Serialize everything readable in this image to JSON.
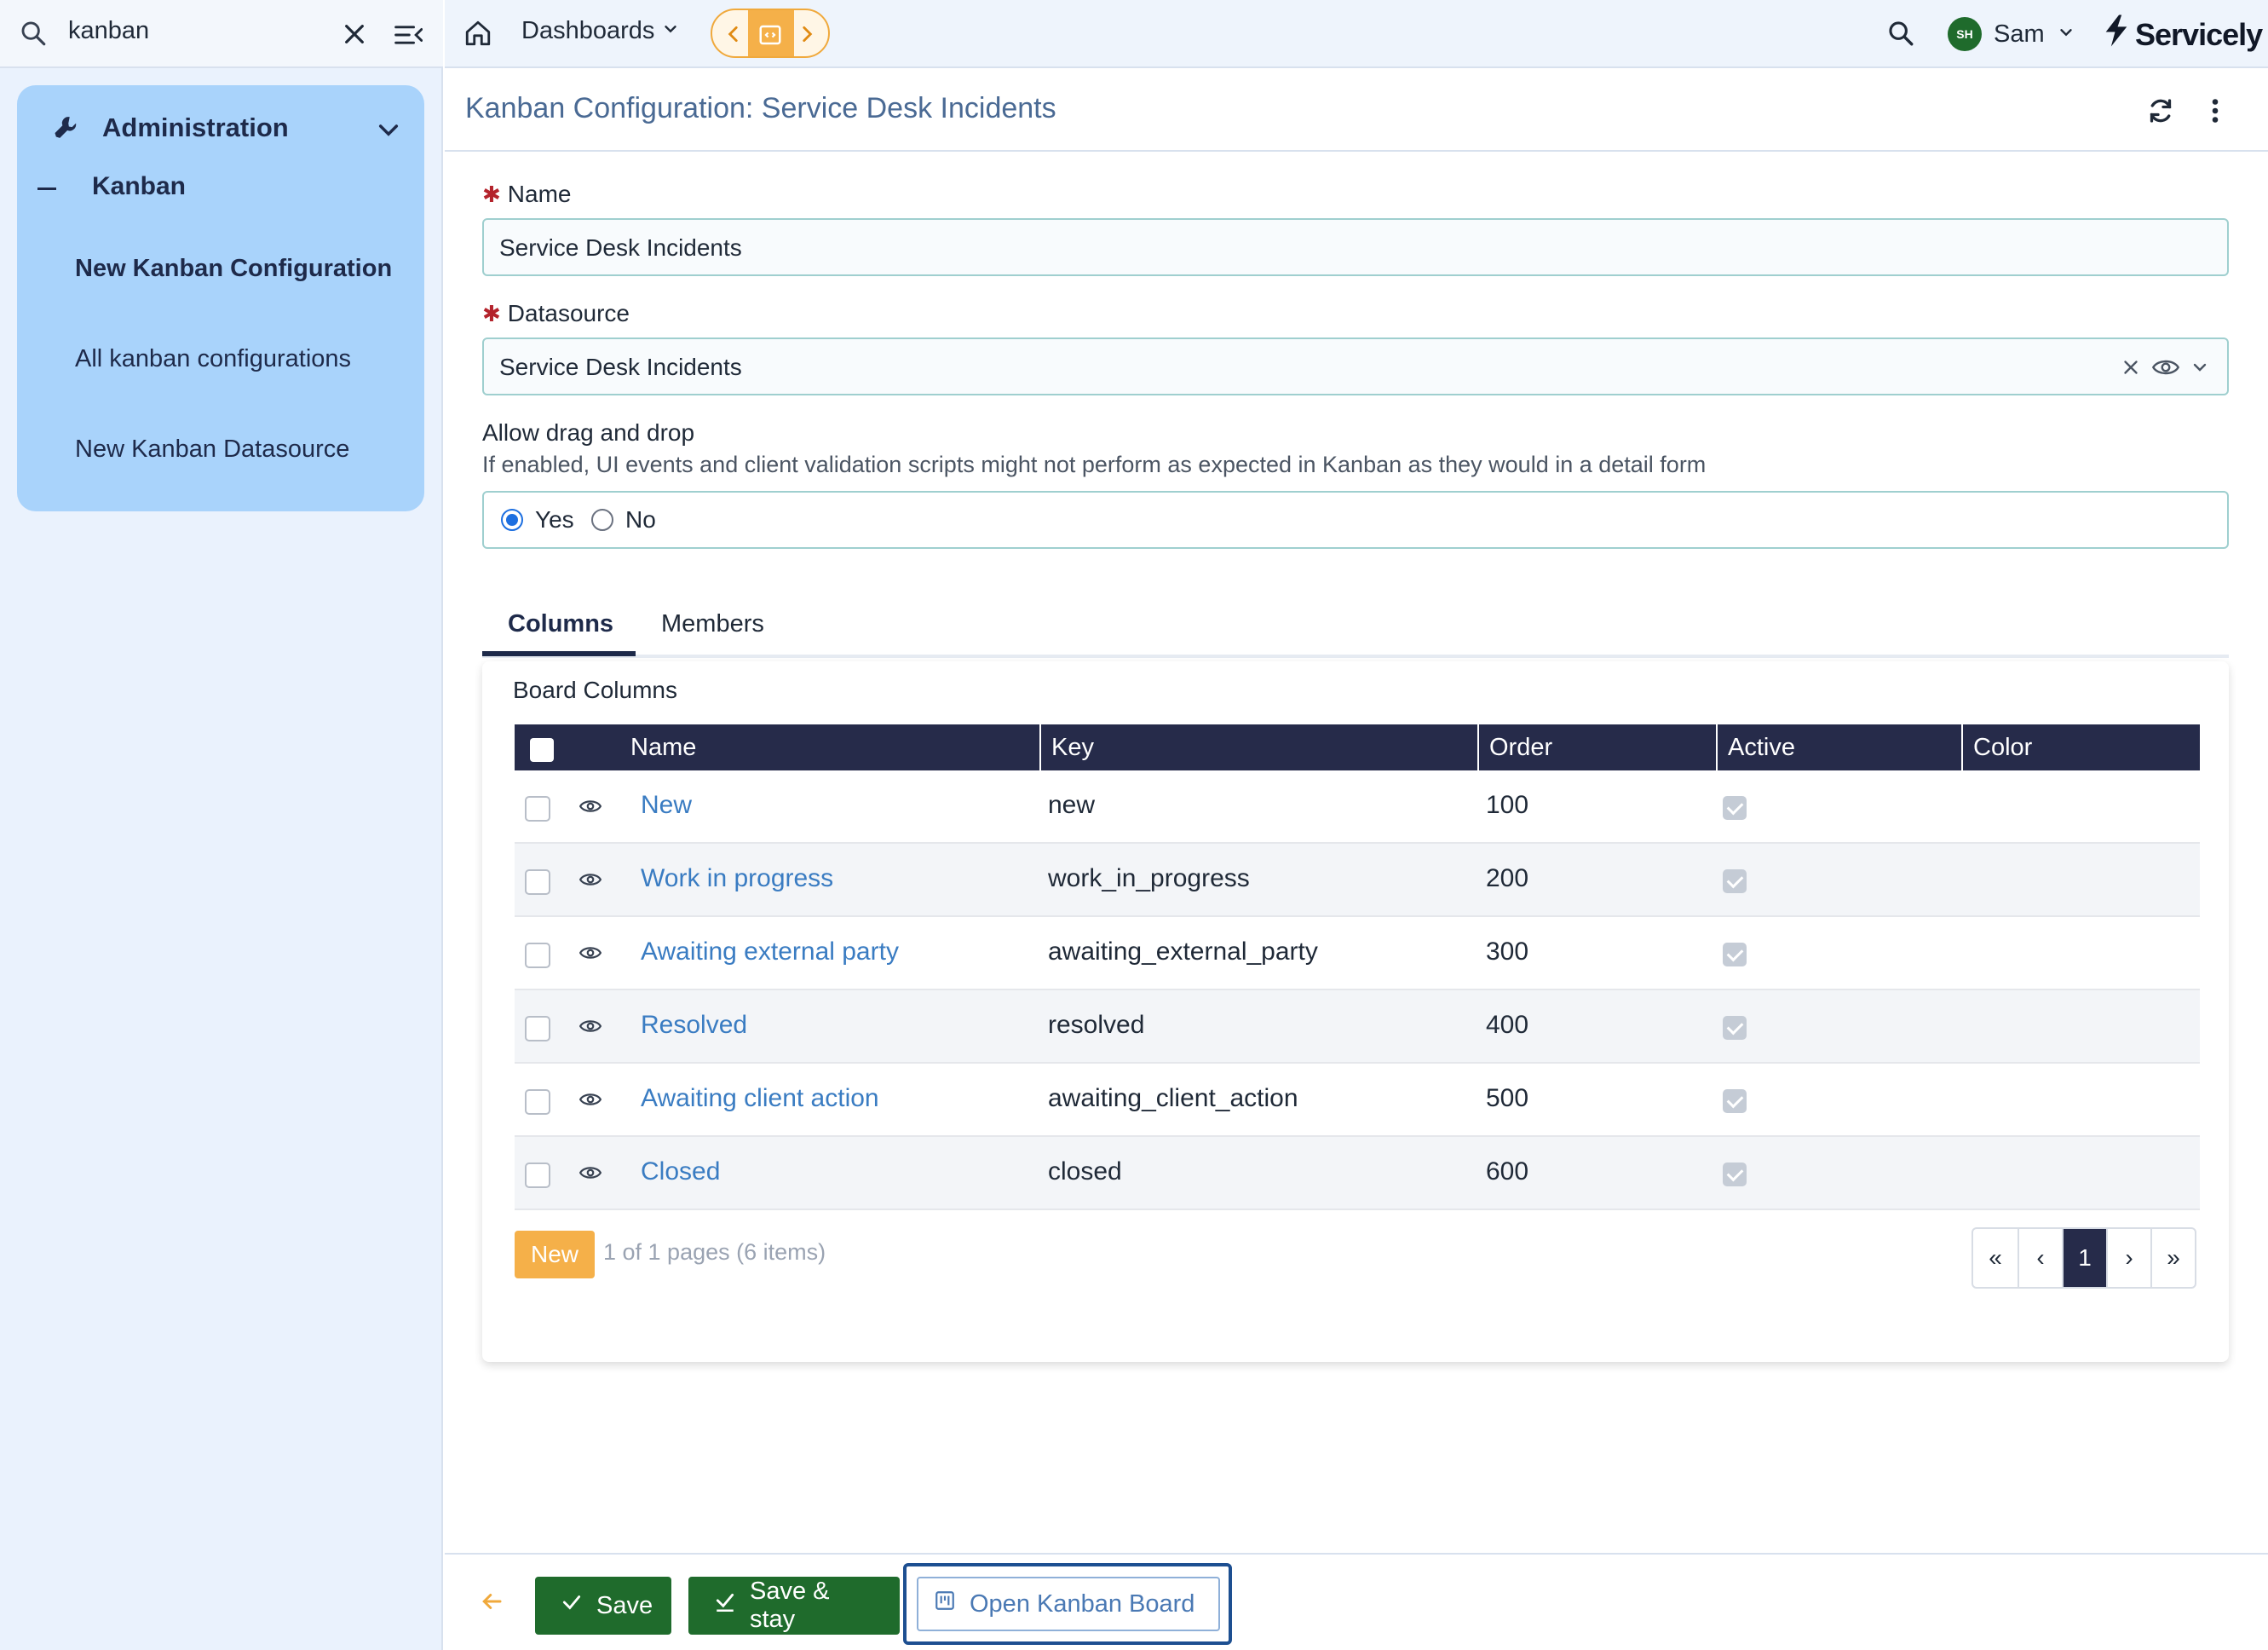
{
  "sidebar": {
    "search_value": "kanban",
    "section_title": "Administration",
    "group_title": "Kanban",
    "items": [
      {
        "label": "New Kanban Configuration"
      },
      {
        "label": "All kanban configurations"
      },
      {
        "label": "New Kanban Datasource"
      }
    ]
  },
  "topbar": {
    "dashboards_label": "Dashboards",
    "user_initials": "SH",
    "user_name": "Sam",
    "brand": "Servicely"
  },
  "page": {
    "title": "Kanban Configuration: Service Desk Incidents"
  },
  "form": {
    "name_label": "Name",
    "name_value": "Service Desk Incidents",
    "datasource_label": "Datasource",
    "datasource_value": "Service Desk Incidents",
    "drag_label": "Allow drag and drop",
    "drag_hint": "If enabled, UI events and client validation scripts might not perform as expected in Kanban as they would in a detail form",
    "drag_options": [
      {
        "label": "Yes",
        "selected": true
      },
      {
        "label": "No",
        "selected": false
      }
    ]
  },
  "tabs": [
    {
      "label": "Columns",
      "active": true
    },
    {
      "label": "Members",
      "active": false
    }
  ],
  "board_columns": {
    "title": "Board Columns",
    "headers": {
      "name": "Name",
      "key": "Key",
      "order": "Order",
      "active": "Active",
      "color": "Color"
    },
    "rows": [
      {
        "name": "New",
        "key": "new",
        "order": "100",
        "active": true
      },
      {
        "name": "Work in progress",
        "key": "work_in_progress",
        "order": "200",
        "active": true
      },
      {
        "name": "Awaiting external party",
        "key": "awaiting_external_party",
        "order": "300",
        "active": true
      },
      {
        "name": "Resolved",
        "key": "resolved",
        "order": "400",
        "active": true
      },
      {
        "name": "Awaiting client action",
        "key": "awaiting_client_action",
        "order": "500",
        "active": true
      },
      {
        "name": "Closed",
        "key": "closed",
        "order": "600",
        "active": true
      }
    ],
    "new_label": "New",
    "pager_info": "1 of 1 pages (6 items)",
    "current_page": "1"
  },
  "footer": {
    "save_label": "Save",
    "save_stay_label": "Save & stay",
    "open_board_label": "Open Kanban Board"
  },
  "colors": {
    "accent_orange": "#f5b049",
    "primary_green": "#1f6b2c",
    "header_navy": "#262b4a",
    "link_blue": "#3a7cc2",
    "sidebar_panel": "#a9d3fb"
  }
}
